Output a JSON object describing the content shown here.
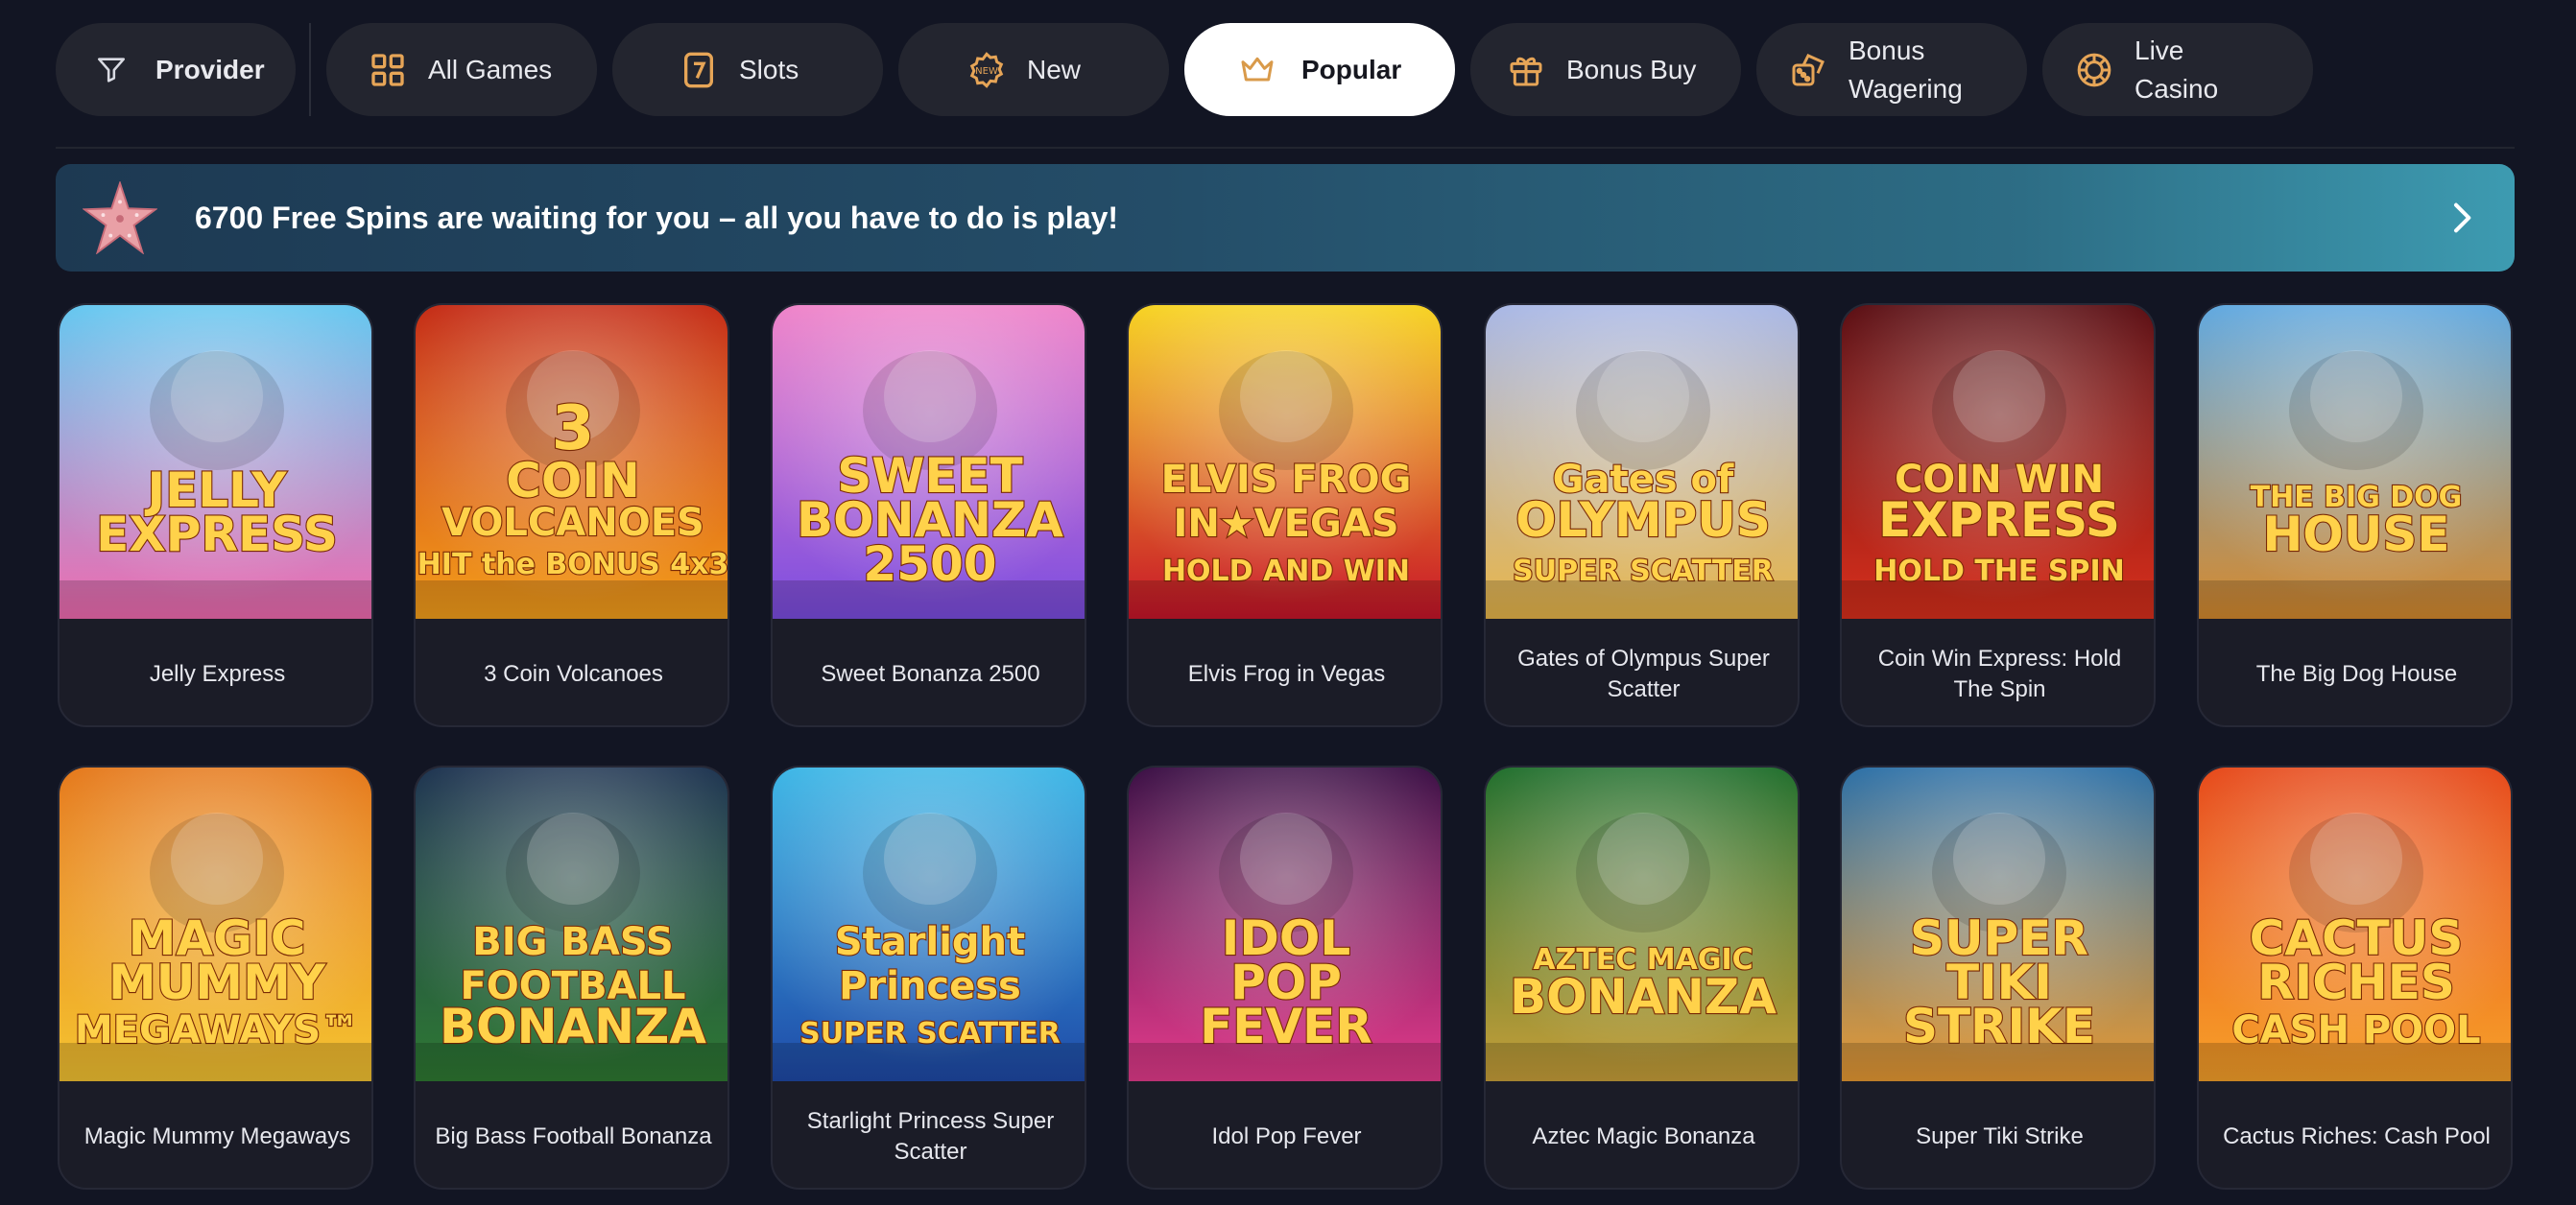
{
  "filters": {
    "provider": {
      "label": "Provider",
      "icon": "filter-icon"
    },
    "categories": [
      {
        "label": "All Games",
        "icon": "grid-icon",
        "active": false
      },
      {
        "label": "Slots",
        "icon": "slot-seven-icon",
        "active": false
      },
      {
        "label": "New",
        "icon": "new-badge-icon",
        "active": false
      },
      {
        "label": "Popular",
        "icon": "crown-icon",
        "active": true
      },
      {
        "label": "Bonus Buy",
        "icon": "gift-icon",
        "active": false
      },
      {
        "label": "Bonus Wagering",
        "label_line1": "Bonus",
        "label_line2": "Wagering",
        "icon": "dice-icon",
        "active": false
      },
      {
        "label": "Live Casino",
        "label_line1": "Live",
        "label_line2": "Casino",
        "icon": "chip-icon",
        "active": false
      }
    ]
  },
  "banner": {
    "text": "6700 Free Spins are waiting for you – all you have to do is play!",
    "icon": "starfish-icon",
    "arrow_icon": "chevron-right-icon"
  },
  "games": [
    {
      "title": "Jelly Express",
      "logo": [
        "JELLY",
        "EXPRESS"
      ],
      "colors": [
        "#63c7f0",
        "#f06bb0"
      ]
    },
    {
      "title": "3 Coin Volcanoes",
      "logo": [
        "3",
        "COIN",
        "VOLCANOES",
        "HIT the BONUS 4x3"
      ],
      "colors": [
        "#c42a14",
        "#f5a01c"
      ]
    },
    {
      "title": "Sweet Bonanza 2500",
      "logo": [
        "SWEET",
        "BONANZA",
        "2500"
      ],
      "colors": [
        "#ef83c9",
        "#7b4de0"
      ]
    },
    {
      "title": "Elvis Frog in Vegas",
      "logo": [
        "ELVIS FROG",
        "IN★VEGAS",
        "HOLD AND WIN"
      ],
      "colors": [
        "#f7d321",
        "#c9152a"
      ]
    },
    {
      "title": "Gates of Olympus Super Scatter",
      "logo": [
        "Gates of",
        "OLYMPUS",
        "SUPER SCATTER"
      ],
      "colors": [
        "#a8b7e6",
        "#e8b64a"
      ]
    },
    {
      "title": "Coin Win Express: Hold The Spin",
      "logo": [
        "COIN WIN",
        "EXPRESS",
        "HOLD THE SPIN"
      ],
      "colors": [
        "#5a0d12",
        "#d9301d"
      ]
    },
    {
      "title": "The Big Dog House",
      "logo": [
        "THE BIG DOG",
        "HOUSE"
      ],
      "colors": [
        "#5fa8e0",
        "#d68a2e"
      ]
    },
    {
      "title": "Magic Mummy Megaways",
      "logo": [
        "MAGIC",
        "MUMMY",
        "MEGAWAYS™"
      ],
      "colors": [
        "#e5781a",
        "#f5c432"
      ]
    },
    {
      "title": "Big Bass Football Bonanza",
      "logo": [
        "BIG BASS",
        "FOOTBALL",
        "BONANZA"
      ],
      "colors": [
        "#1d3350",
        "#2f7a33"
      ]
    },
    {
      "title": "Starlight Princess Super Scatter",
      "logo": [
        "Starlight",
        "Princess",
        "SUPER SCATTER"
      ],
      "colors": [
        "#3cb6e6",
        "#1f4aa8"
      ]
    },
    {
      "title": "Idol Pop Fever",
      "logo": [
        "IDOL",
        "POP",
        "FEVER"
      ],
      "colors": [
        "#3a0e44",
        "#e43c8c"
      ]
    },
    {
      "title": "Aztec Magic Bonanza",
      "logo": [
        "AZTEC MAGIC",
        "BONANZA"
      ],
      "colors": [
        "#1f6e2c",
        "#c9a03a"
      ]
    },
    {
      "title": "Super Tiki Strike",
      "logo": [
        "SUPER",
        "TIKI",
        "STRIKE"
      ],
      "colors": [
        "#2b6fa6",
        "#e89a33"
      ]
    },
    {
      "title": "Cactus Riches: Cash Pool",
      "logo": [
        "CACTUS",
        "RICHES",
        "CASH POOL"
      ],
      "colors": [
        "#e64819",
        "#f7a12a"
      ]
    }
  ]
}
